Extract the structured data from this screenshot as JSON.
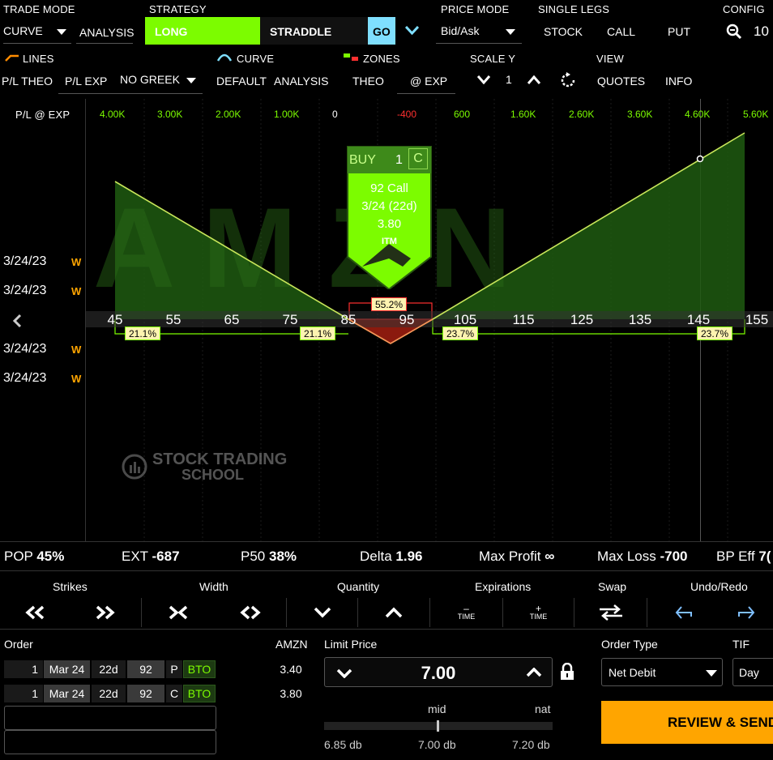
{
  "top": {
    "trade_mode_label": "TRADE MODE",
    "trade_mode_value": "CURVE",
    "analysis_label": "ANALYSIS",
    "strategy_label": "STRATEGY",
    "strategy_long": "LONG",
    "strategy_straddle": "STRADDLE",
    "go_label": "GO",
    "price_mode_label": "PRICE MODE",
    "price_mode_value": "Bid/Ask",
    "single_legs_label": "SINGLE LEGS",
    "stock_label": "STOCK",
    "call_label": "CALL",
    "put_label": "PUT",
    "config_label": "CONFIG",
    "zoom_value": "10"
  },
  "second": {
    "lines_label": "LINES",
    "curve_label": "CURVE",
    "zones_label": "ZONES",
    "scale_y_label": "SCALE Y",
    "view_label": "VIEW",
    "pl_theo": "P/L THEO",
    "pl_exp": "P/L EXP",
    "no_greek": "NO GREEK",
    "default": "DEFAULT",
    "analysis": "ANALYSIS",
    "theo": "THEO",
    "at_exp": "@ EXP",
    "scale_value": "1",
    "quotes": "QUOTES",
    "info": "INFO"
  },
  "chart_header": {
    "label": "P/L @ EXP",
    "values": [
      {
        "text": "4.00",
        "unit": "K",
        "color": "g"
      },
      {
        "text": "3.00",
        "unit": "K",
        "color": "g"
      },
      {
        "text": "2.00",
        "unit": "K",
        "color": "g"
      },
      {
        "text": "1.00",
        "unit": "K",
        "color": "g"
      },
      {
        "text": "0",
        "unit": "",
        "color": "w"
      },
      {
        "text": "-400",
        "unit": "",
        "color": "r"
      },
      {
        "text": "600",
        "unit": "",
        "color": "g"
      },
      {
        "text": "1.60",
        "unit": "K",
        "color": "g"
      },
      {
        "text": "2.60",
        "unit": "K",
        "color": "g"
      },
      {
        "text": "3.60",
        "unit": "K",
        "color": "g"
      },
      {
        "text": "4.60",
        "unit": "K",
        "color": "g"
      },
      {
        "text": "5.60",
        "unit": "K",
        "color": "g"
      }
    ]
  },
  "dates": [
    {
      "date": "3/24/23",
      "badge": "W"
    },
    {
      "date": "3/24/23",
      "badge": "W"
    },
    {
      "date": "3/24/23",
      "badge": "W"
    },
    {
      "date": "3/24/23",
      "badge": "W"
    }
  ],
  "strikes": [
    "45",
    "55",
    "65",
    "75",
    "85",
    "95",
    "105",
    "115",
    "125",
    "135",
    "145",
    "155"
  ],
  "probabilities": [
    "21.1%",
    "21.1%",
    "55.2%",
    "23.7%",
    "23.7%"
  ],
  "popup": {
    "action": "BUY",
    "qty": "1",
    "type_letter": "C",
    "line1": "92 Call",
    "line2": "3/24 (22d)",
    "line3": "3.80",
    "itm": "ITM"
  },
  "watermark": {
    "line1": "STOCK TRADING",
    "line2": "SCHOOL"
  },
  "stats": {
    "pop_label": "POP",
    "pop_value": "45%",
    "ext_label": "EXT",
    "ext_value": "-687",
    "p50_label": "P50",
    "p50_value": "38%",
    "delta_label": "Delta",
    "delta_value": "1.96",
    "max_profit_label": "Max Profit",
    "max_profit_value": "∞",
    "max_loss_label": "Max Loss",
    "max_loss_value": "-700",
    "bp_label": "BP Eff",
    "bp_value": "7("
  },
  "controls": {
    "strikes": "Strikes",
    "width": "Width",
    "quantity": "Quantity",
    "expirations": "Expirations",
    "swap": "Swap",
    "undo_redo": "Undo/Redo",
    "time": "TIME"
  },
  "order": {
    "label": "Order",
    "symbol": "AMZN",
    "legs": [
      {
        "qty": "1",
        "exp": "Mar 24",
        "days": "22d",
        "strike": "92",
        "type": "P",
        "action": "BTO",
        "price": "3.40"
      },
      {
        "qty": "1",
        "exp": "Mar 24",
        "days": "22d",
        "strike": "92",
        "type": "C",
        "action": "BTO",
        "price": "3.80"
      }
    ]
  },
  "limit": {
    "label": "Limit Price",
    "value": "7.00",
    "mid_label": "mid",
    "nat_label": "nat",
    "low": "6.85 db",
    "mid": "7.00 db",
    "high": "7.20 db"
  },
  "order_type": {
    "label": "Order Type",
    "value": "Net Debit",
    "tif_label": "TIF",
    "tif_value": "Day",
    "review": "REVIEW & SEND"
  },
  "colors": {
    "green": "#7cfc00",
    "red": "#ff3030",
    "orange": "#ffa500",
    "cyan": "#7fdfff"
  }
}
